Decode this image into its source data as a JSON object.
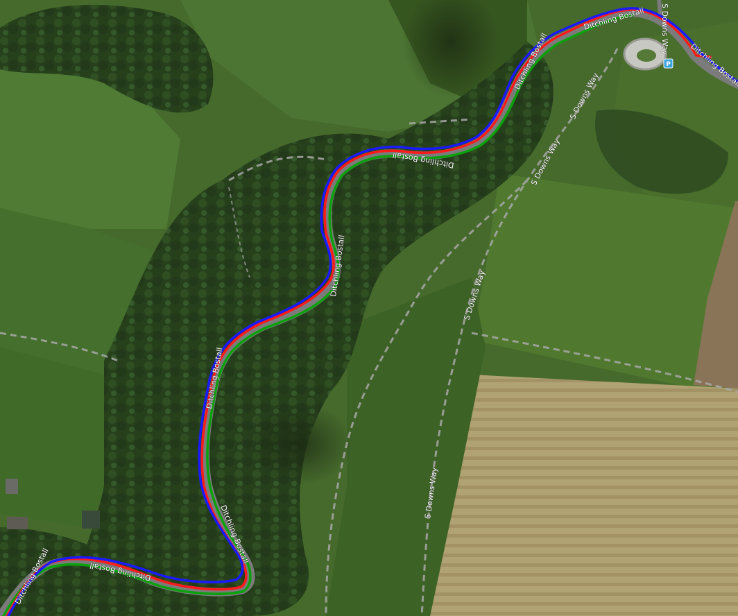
{
  "map": {
    "view": "satellite",
    "road_names": {
      "ditchling_bostall": "Ditchling Bostall",
      "south_downs_way": "S Downs Way"
    },
    "parking_icon_symbol": "P",
    "tracks": [
      {
        "key": "red",
        "color": "#ff1a1a"
      },
      {
        "key": "green",
        "color": "#0aa20a"
      },
      {
        "key": "blue",
        "color": "#1a1aff"
      }
    ],
    "colors": {
      "road": "#7b7b7b",
      "footpath": "#a8a8a8",
      "woodland": "#27401c",
      "field_dark": "#3f6a2a",
      "field_light": "#5a7f34",
      "arable": "#a89a6a",
      "parking_icon": "#3aa3e0"
    }
  }
}
